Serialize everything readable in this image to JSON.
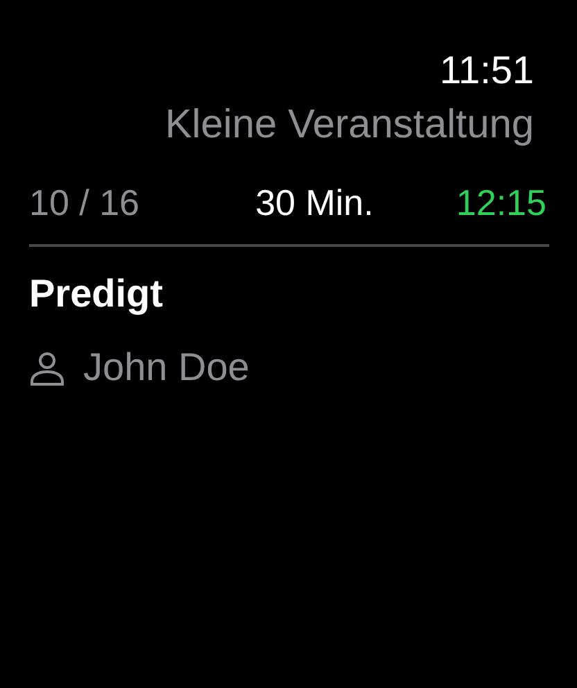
{
  "status_bar": {
    "time": "11:51"
  },
  "title": "Kleine Veranstaltung",
  "summary": {
    "position": "10 / 16",
    "duration": "30 Min.",
    "end_time": "12:15"
  },
  "item": {
    "title": "Predigt",
    "person": "John Doe"
  }
}
